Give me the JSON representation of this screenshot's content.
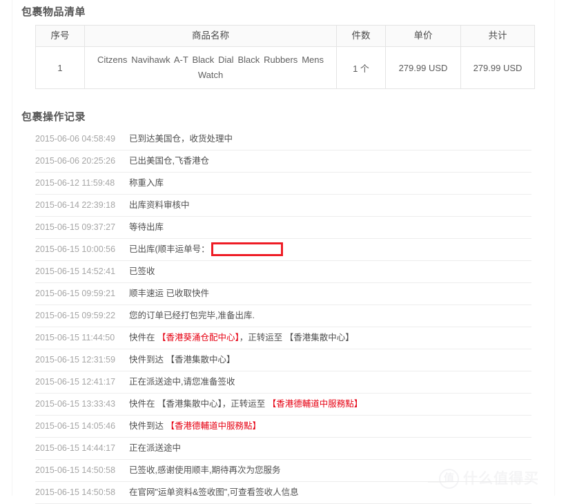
{
  "sections": {
    "items_title": "包裹物品清单",
    "log_title": "包裹操作记录"
  },
  "items_table": {
    "headers": {
      "index": "序号",
      "name": "商品名称",
      "quantity": "件数",
      "unit_price": "单价",
      "total": "共计"
    },
    "rows": [
      {
        "index": "1",
        "name": "Citzens Navihawk A-T Black Dial Black Rubbers Mens Watch",
        "quantity": "1 个",
        "unit_price": "279.99 USD",
        "total": "279.99 USD"
      }
    ]
  },
  "log": {
    "entries": [
      {
        "time": "2015-06-06 04:58:49",
        "text": "已到达美国仓，收货处理中"
      },
      {
        "time": "2015-06-06 20:25:26",
        "text": "已出美国仓,飞香港仓"
      },
      {
        "time": "2015-06-12 11:59:48",
        "text": "称重入库"
      },
      {
        "time": "2015-06-14 22:39:18",
        "text": "出库资料审核中"
      },
      {
        "time": "2015-06-15 09:37:27",
        "text": "等待出库"
      },
      {
        "time": "2015-06-15 10:00:56",
        "text": "已出库(顺丰运单号：",
        "redacted": true
      },
      {
        "time": "2015-06-15 14:52:41",
        "text": "已签收"
      },
      {
        "time": "2015-06-15 09:59:21",
        "text": "顺丰速运 已收取快件"
      },
      {
        "time": "2015-06-15 09:59:22",
        "text": "您的订单已经打包完毕,准备出库."
      },
      {
        "time": "2015-06-15 11:44:50",
        "pre": "快件在 ",
        "highlight": "【香港葵涌仓配中心】",
        "post": "，正转运至 【香港集散中心】"
      },
      {
        "time": "2015-06-15 12:31:59",
        "text": "快件到达 【香港集散中心】"
      },
      {
        "time": "2015-06-15 12:41:17",
        "text": "正在派送途中,请您准备签收"
      },
      {
        "time": "2015-06-15 13:33:43",
        "pre": "快件在 【香港集散中心】，正转运至 ",
        "highlight": "【香港德輔道中服務點】",
        "post": ""
      },
      {
        "time": "2015-06-15 14:05:46",
        "pre": "快件到达 ",
        "highlight": "【香港德輔道中服務點】",
        "post": ""
      },
      {
        "time": "2015-06-15 14:44:17",
        "text": "正在派送途中"
      },
      {
        "time": "2015-06-15 14:50:58",
        "text": "已签收,感谢使用顺丰,期待再次为您服务"
      },
      {
        "time": "2015-06-15 14:50:58",
        "text": "在官网\"运单资料&签收图\",可查看签收人信息"
      }
    ]
  },
  "watermark": {
    "logo_char": "值",
    "text": "什么值得买"
  },
  "colors": {
    "highlight_red": "#e60012",
    "redaction_red": "#ee1c25",
    "text": "#4f4f4f",
    "muted": "#a6a6a6",
    "border": "#e4e4e4"
  }
}
